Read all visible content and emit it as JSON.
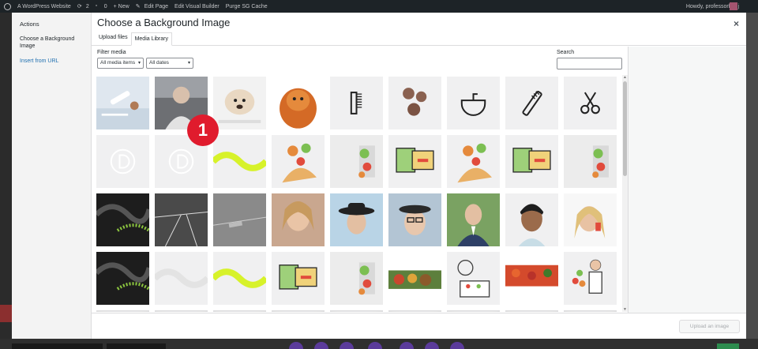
{
  "admin_bar": {
    "site_name": "A WordPress Website",
    "updates": "2",
    "comments": "0",
    "new": "+ New",
    "edit_page": "Edit Page",
    "visual_builder": "Edit Visual Builder",
    "purge": "Purge SG Cache",
    "greeting": "Howdy, professorbeej"
  },
  "modal": {
    "actions_title": "Actions",
    "menu_items": [
      "Choose a Background Image",
      "Insert from URL"
    ],
    "title": "Choose a Background Image",
    "close": "×",
    "tabs": [
      "Upload files",
      "Media Library"
    ],
    "active_tab": "Media Library",
    "filter_label": "Filter media",
    "filter_type": "All media items",
    "filter_date": "All dates",
    "search_label": "Search",
    "search_value": "",
    "upload_button": "Upload an image"
  },
  "media_grid": {
    "thumbnails": [
      "photo-cosmetics-swabs",
      "photo-woman-headphones",
      "photo-dog-on-table",
      "photo-fluffy-dog",
      "icon-comb",
      "photo-star-cookies",
      "icon-sink",
      "icon-hairbrush",
      "icon-scissors",
      "logo-divi",
      "logo-divi",
      "graphic-yellow-squiggle",
      "illustration-food",
      "illustration-vegetables-bag",
      "illustration-coupons",
      "illustration-food",
      "illustration-coupons",
      "illustration-vegetables-bag",
      "photo-dark-pattern",
      "photo-tennis-court",
      "photo-tennis-gray",
      "photo-woman-smiling",
      "photo-woman-hat",
      "photo-woman-glasses",
      "photo-man-suit",
      "photo-man-smiling",
      "photo-woman-phone",
      "photo-dark-pattern",
      "graphic-gray-squiggle",
      "graphic-yellow-squiggle",
      "illustration-coupons",
      "illustration-vegetables-bag",
      "photo-vegetables",
      "illustration-kitchen",
      "photo-market-produce",
      "illustration-chef"
    ]
  },
  "badge": "1",
  "colors": {
    "accent": "#2271b1",
    "badge": "#e01b2d",
    "admin_bar": "#1d2327"
  }
}
